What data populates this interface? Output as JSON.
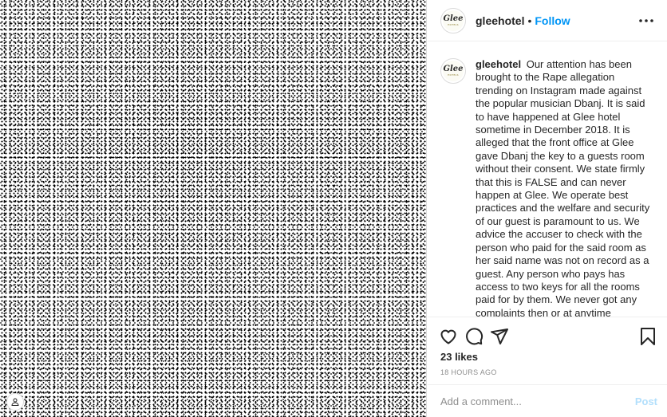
{
  "header": {
    "username": "gleehotel",
    "separator": "•",
    "follow_label": "Follow",
    "avatar_logo": "Glee",
    "avatar_logo_sub": "HOTELS",
    "more_icon": "more-horizontal-icon"
  },
  "caption": {
    "username": "gleehotel",
    "text": "Our attention has been brought to the Rape allegation trending on Instagram made against the popular musician Dbanj. It is said to have happened at Glee hotel sometime in December 2018. It is alleged that the front office at Glee gave Dbanj the key to a guests room without their consent. We state firmly that this is FALSE and can never happen at Glee. We operate best practices and the welfare and security of our guest is paramount to us. We advice the accuser to check with the person who paid for the said room as her said name was not on record as a guest. Any person who pays has access to two keys for all the rooms paid for by them. We never got any complaints then or at anytime"
  },
  "actions": {
    "like_icon": "heart-icon",
    "comment_icon": "comment-icon",
    "share_icon": "share-icon",
    "save_icon": "bookmark-icon"
  },
  "likes_text": "23 likes",
  "timestamp": "18 HOURS AGO",
  "comment_box": {
    "placeholder": "Add a comment...",
    "post_label": "Post"
  },
  "media": {
    "user_tag_icon": "user-icon"
  },
  "colors": {
    "link": "#0095f6",
    "post_disabled": "#b2dffc",
    "muted": "#8e8e8e",
    "border": "#efefef"
  }
}
